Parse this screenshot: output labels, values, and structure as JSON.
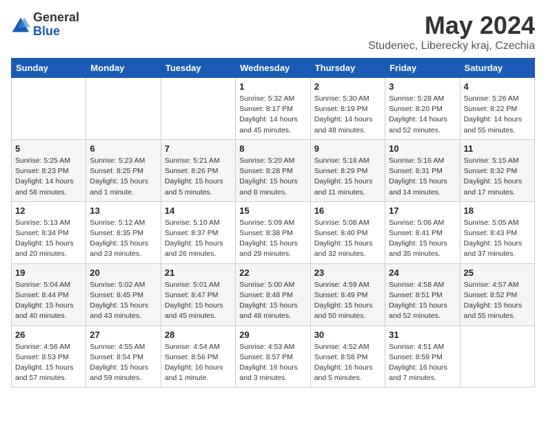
{
  "logo": {
    "general": "General",
    "blue": "Blue"
  },
  "header": {
    "title": "May 2024",
    "subtitle": "Studenec, Liberecky kraj, Czechia"
  },
  "weekdays": [
    "Sunday",
    "Monday",
    "Tuesday",
    "Wednesday",
    "Thursday",
    "Friday",
    "Saturday"
  ],
  "weeks": [
    [
      {
        "day": "",
        "info": ""
      },
      {
        "day": "",
        "info": ""
      },
      {
        "day": "",
        "info": ""
      },
      {
        "day": "1",
        "info": "Sunrise: 5:32 AM\nSunset: 8:17 PM\nDaylight: 14 hours\nand 45 minutes."
      },
      {
        "day": "2",
        "info": "Sunrise: 5:30 AM\nSunset: 8:19 PM\nDaylight: 14 hours\nand 48 minutes."
      },
      {
        "day": "3",
        "info": "Sunrise: 5:28 AM\nSunset: 8:20 PM\nDaylight: 14 hours\nand 52 minutes."
      },
      {
        "day": "4",
        "info": "Sunrise: 5:26 AM\nSunset: 8:22 PM\nDaylight: 14 hours\nand 55 minutes."
      }
    ],
    [
      {
        "day": "5",
        "info": "Sunrise: 5:25 AM\nSunset: 8:23 PM\nDaylight: 14 hours\nand 58 minutes."
      },
      {
        "day": "6",
        "info": "Sunrise: 5:23 AM\nSunset: 8:25 PM\nDaylight: 15 hours\nand 1 minute."
      },
      {
        "day": "7",
        "info": "Sunrise: 5:21 AM\nSunset: 8:26 PM\nDaylight: 15 hours\nand 5 minutes."
      },
      {
        "day": "8",
        "info": "Sunrise: 5:20 AM\nSunset: 8:28 PM\nDaylight: 15 hours\nand 8 minutes."
      },
      {
        "day": "9",
        "info": "Sunrise: 5:18 AM\nSunset: 8:29 PM\nDaylight: 15 hours\nand 11 minutes."
      },
      {
        "day": "10",
        "info": "Sunrise: 5:16 AM\nSunset: 8:31 PM\nDaylight: 15 hours\nand 14 minutes."
      },
      {
        "day": "11",
        "info": "Sunrise: 5:15 AM\nSunset: 8:32 PM\nDaylight: 15 hours\nand 17 minutes."
      }
    ],
    [
      {
        "day": "12",
        "info": "Sunrise: 5:13 AM\nSunset: 8:34 PM\nDaylight: 15 hours\nand 20 minutes."
      },
      {
        "day": "13",
        "info": "Sunrise: 5:12 AM\nSunset: 8:35 PM\nDaylight: 15 hours\nand 23 minutes."
      },
      {
        "day": "14",
        "info": "Sunrise: 5:10 AM\nSunset: 8:37 PM\nDaylight: 15 hours\nand 26 minutes."
      },
      {
        "day": "15",
        "info": "Sunrise: 5:09 AM\nSunset: 8:38 PM\nDaylight: 15 hours\nand 29 minutes."
      },
      {
        "day": "16",
        "info": "Sunrise: 5:08 AM\nSunset: 8:40 PM\nDaylight: 15 hours\nand 32 minutes."
      },
      {
        "day": "17",
        "info": "Sunrise: 5:06 AM\nSunset: 8:41 PM\nDaylight: 15 hours\nand 35 minutes."
      },
      {
        "day": "18",
        "info": "Sunrise: 5:05 AM\nSunset: 8:43 PM\nDaylight: 15 hours\nand 37 minutes."
      }
    ],
    [
      {
        "day": "19",
        "info": "Sunrise: 5:04 AM\nSunset: 8:44 PM\nDaylight: 15 hours\nand 40 minutes."
      },
      {
        "day": "20",
        "info": "Sunrise: 5:02 AM\nSunset: 8:45 PM\nDaylight: 15 hours\nand 43 minutes."
      },
      {
        "day": "21",
        "info": "Sunrise: 5:01 AM\nSunset: 8:47 PM\nDaylight: 15 hours\nand 45 minutes."
      },
      {
        "day": "22",
        "info": "Sunrise: 5:00 AM\nSunset: 8:48 PM\nDaylight: 15 hours\nand 48 minutes."
      },
      {
        "day": "23",
        "info": "Sunrise: 4:59 AM\nSunset: 8:49 PM\nDaylight: 15 hours\nand 50 minutes."
      },
      {
        "day": "24",
        "info": "Sunrise: 4:58 AM\nSunset: 8:51 PM\nDaylight: 15 hours\nand 52 minutes."
      },
      {
        "day": "25",
        "info": "Sunrise: 4:57 AM\nSunset: 8:52 PM\nDaylight: 15 hours\nand 55 minutes."
      }
    ],
    [
      {
        "day": "26",
        "info": "Sunrise: 4:56 AM\nSunset: 8:53 PM\nDaylight: 15 hours\nand 57 minutes."
      },
      {
        "day": "27",
        "info": "Sunrise: 4:55 AM\nSunset: 8:54 PM\nDaylight: 15 hours\nand 59 minutes."
      },
      {
        "day": "28",
        "info": "Sunrise: 4:54 AM\nSunset: 8:56 PM\nDaylight: 16 hours\nand 1 minute."
      },
      {
        "day": "29",
        "info": "Sunrise: 4:53 AM\nSunset: 8:57 PM\nDaylight: 16 hours\nand 3 minutes."
      },
      {
        "day": "30",
        "info": "Sunrise: 4:52 AM\nSunset: 8:58 PM\nDaylight: 16 hours\nand 5 minutes."
      },
      {
        "day": "31",
        "info": "Sunrise: 4:51 AM\nSunset: 8:59 PM\nDaylight: 16 hours\nand 7 minutes."
      },
      {
        "day": "",
        "info": ""
      }
    ]
  ]
}
